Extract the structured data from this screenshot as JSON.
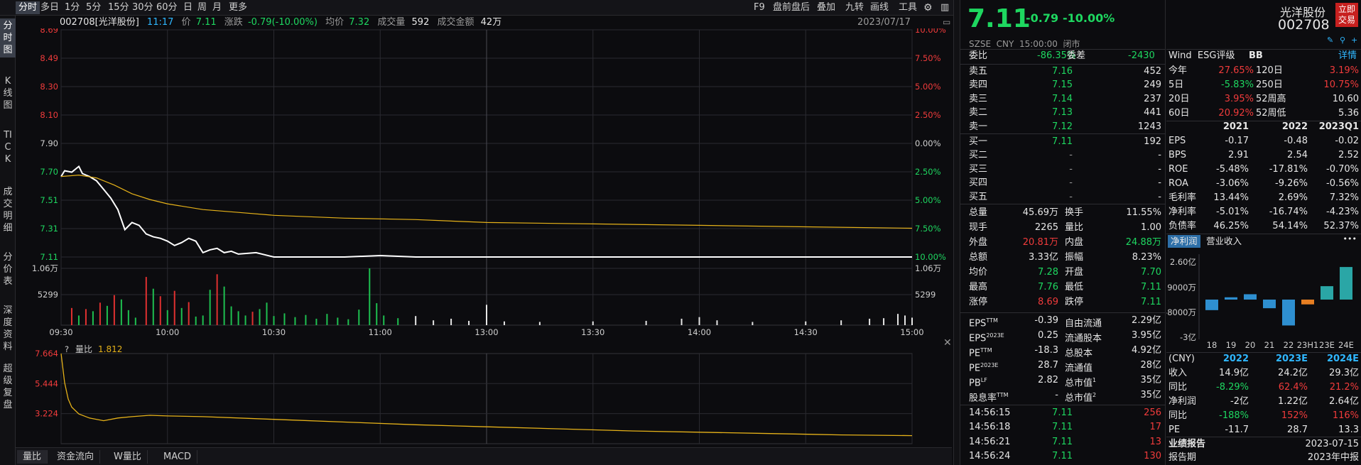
{
  "toolbar": {
    "periods": [
      "分时",
      "多日",
      "1分",
      "5分",
      "15分",
      "30分",
      "60分",
      "日",
      "周",
      "月",
      "更多"
    ],
    "right_items": [
      "F9",
      "盘前盘后",
      "叠加",
      "九转",
      "画线",
      "工具"
    ]
  },
  "left_tabs": [
    "分时图",
    "K线图",
    "TICK",
    "成交明细",
    "分价表",
    "深度资料",
    "超级复盘"
  ],
  "info": {
    "code_name": "002708[光洋股份]",
    "time": "11:17",
    "price_label": "价",
    "price": "7.11",
    "change_label": "涨跌",
    "change": "-0.79(-10.00%)",
    "avg_label": "均价",
    "avg": "7.32",
    "vol_label": "成交量",
    "vol": "592",
    "amount_label": "成交金额",
    "amount": "42万",
    "date": "2023/07/17"
  },
  "chart_data": {
    "type": "line",
    "title": "",
    "price_axis": [
      "8.69",
      "8.49",
      "8.30",
      "8.10",
      "7.90",
      "7.70",
      "7.51",
      "7.31",
      "7.11"
    ],
    "pct_axis": [
      "10.00%",
      "7.50%",
      "5.00%",
      "2.50%",
      "0.00%",
      "2.50%",
      "5.00%",
      "7.50%",
      "10.00%"
    ],
    "vol_axis": [
      "1.06万",
      "5299"
    ],
    "x_ticks": [
      "09:30",
      "10:00",
      "10:30",
      "11:00",
      "13:00",
      "13:30",
      "14:00",
      "14:30",
      "15:00"
    ],
    "prev_close": 7.9,
    "ylim": [
      7.11,
      8.69
    ],
    "series": [
      {
        "name": "价格",
        "color": "#ffffff",
        "x": [
          0,
          1,
          3,
          5,
          6,
          8,
          10,
          12,
          14,
          16,
          18,
          20,
          22,
          24,
          26,
          28,
          30,
          32,
          34,
          36,
          38,
          40,
          42,
          44,
          46,
          48,
          50,
          55,
          60,
          70,
          80,
          90,
          100,
          110,
          120,
          130,
          150,
          170,
          190,
          210,
          240
        ],
        "y": [
          7.67,
          7.71,
          7.7,
          7.74,
          7.69,
          7.67,
          7.64,
          7.58,
          7.52,
          7.44,
          7.3,
          7.35,
          7.33,
          7.27,
          7.25,
          7.24,
          7.22,
          7.19,
          7.21,
          7.24,
          7.22,
          7.14,
          7.16,
          7.17,
          7.14,
          7.15,
          7.13,
          7.14,
          7.11,
          7.11,
          7.11,
          7.12,
          7.11,
          7.11,
          7.11,
          7.11,
          7.11,
          7.11,
          7.11,
          7.11,
          7.11
        ]
      },
      {
        "name": "均价",
        "color": "#e6b219",
        "x": [
          0,
          5,
          10,
          15,
          20,
          25,
          30,
          40,
          50,
          60,
          80,
          100,
          120,
          150,
          180,
          210,
          240
        ],
        "y": [
          7.67,
          7.68,
          7.66,
          7.61,
          7.55,
          7.51,
          7.48,
          7.44,
          7.42,
          7.4,
          7.38,
          7.37,
          7.35,
          7.34,
          7.33,
          7.32,
          7.31
        ]
      }
    ],
    "volume_max": 10600,
    "volume_bars": [
      {
        "t": 3,
        "v": 3200,
        "c": "r"
      },
      {
        "t": 5,
        "v": 1800,
        "c": "g"
      },
      {
        "t": 7,
        "v": 3000,
        "c": "r"
      },
      {
        "t": 9,
        "v": 2600,
        "c": "g"
      },
      {
        "t": 11,
        "v": 4200,
        "c": "r"
      },
      {
        "t": 13,
        "v": 3600,
        "c": "g"
      },
      {
        "t": 15,
        "v": 5600,
        "c": "r"
      },
      {
        "t": 17,
        "v": 4800,
        "c": "g"
      },
      {
        "t": 19,
        "v": 2800,
        "c": "g"
      },
      {
        "t": 21,
        "v": 1400,
        "c": "g"
      },
      {
        "t": 24,
        "v": 9000,
        "c": "r"
      },
      {
        "t": 26,
        "v": 6800,
        "c": "g"
      },
      {
        "t": 28,
        "v": 5400,
        "c": "r"
      },
      {
        "t": 30,
        "v": 2800,
        "c": "g"
      },
      {
        "t": 32,
        "v": 6400,
        "c": "r"
      },
      {
        "t": 34,
        "v": 3200,
        "c": "g"
      },
      {
        "t": 36,
        "v": 4300,
        "c": "r"
      },
      {
        "t": 38,
        "v": 1600,
        "c": "g"
      },
      {
        "t": 40,
        "v": 1800,
        "c": "g"
      },
      {
        "t": 42,
        "v": 6600,
        "c": "g"
      },
      {
        "t": 44,
        "v": 9500,
        "c": "r"
      },
      {
        "t": 46,
        "v": 7200,
        "c": "g"
      },
      {
        "t": 48,
        "v": 3500,
        "c": "g"
      },
      {
        "t": 50,
        "v": 2600,
        "c": "g"
      },
      {
        "t": 52,
        "v": 1800,
        "c": "g"
      },
      {
        "t": 54,
        "v": 2500,
        "c": "r"
      },
      {
        "t": 56,
        "v": 3000,
        "c": "g"
      },
      {
        "t": 58,
        "v": 4200,
        "c": "g"
      },
      {
        "t": 60,
        "v": 1700,
        "c": "g"
      },
      {
        "t": 63,
        "v": 2200,
        "c": "g"
      },
      {
        "t": 66,
        "v": 1500,
        "c": "g"
      },
      {
        "t": 69,
        "v": 1900,
        "c": "g"
      },
      {
        "t": 72,
        "v": 1200,
        "c": "g"
      },
      {
        "t": 75,
        "v": 2100,
        "c": "g"
      },
      {
        "t": 78,
        "v": 1400,
        "c": "g"
      },
      {
        "t": 81,
        "v": 1100,
        "c": "g"
      },
      {
        "t": 84,
        "v": 2900,
        "c": "g"
      },
      {
        "t": 87,
        "v": 10600,
        "c": "g"
      },
      {
        "t": 89,
        "v": 4100,
        "c": "g"
      },
      {
        "t": 91,
        "v": 1800,
        "c": "g"
      },
      {
        "t": 95,
        "v": 1300,
        "c": "g"
      },
      {
        "t": 100,
        "v": 1700,
        "c": "w"
      },
      {
        "t": 105,
        "v": 900,
        "c": "w"
      },
      {
        "t": 110,
        "v": 1200,
        "c": "w"
      },
      {
        "t": 115,
        "v": 800,
        "c": "w"
      },
      {
        "t": 120,
        "v": 3800,
        "c": "w"
      },
      {
        "t": 125,
        "v": 700,
        "c": "w"
      },
      {
        "t": 135,
        "v": 600,
        "c": "w"
      },
      {
        "t": 150,
        "v": 700,
        "c": "w"
      },
      {
        "t": 165,
        "v": 800,
        "c": "w"
      },
      {
        "t": 175,
        "v": 1200,
        "c": "w"
      },
      {
        "t": 180,
        "v": 1500,
        "c": "w"
      },
      {
        "t": 185,
        "v": 900,
        "c": "w"
      },
      {
        "t": 195,
        "v": 600,
        "c": "w"
      },
      {
        "t": 210,
        "v": 700,
        "c": "w"
      },
      {
        "t": 220,
        "v": 900,
        "c": "w"
      },
      {
        "t": 228,
        "v": 1200,
        "c": "w"
      },
      {
        "t": 232,
        "v": 1300,
        "c": "w"
      },
      {
        "t": 236,
        "v": 2100,
        "c": "w"
      },
      {
        "t": 238,
        "v": 1800,
        "c": "w"
      },
      {
        "t": 240,
        "v": 1400,
        "c": "w"
      }
    ],
    "ratio": {
      "label": "量比",
      "value": "1.812",
      "axis": [
        "7.664",
        "5.444",
        "3.224"
      ],
      "x": [
        0,
        1,
        2,
        3,
        5,
        8,
        12,
        16,
        20,
        25,
        30,
        40,
        60,
        80,
        100,
        120,
        140,
        160,
        180,
        200,
        220,
        240
      ],
      "y": [
        7.66,
        5.5,
        4.3,
        3.7,
        3.2,
        2.9,
        2.7,
        2.9,
        3.0,
        3.1,
        3.05,
        3.0,
        2.8,
        2.6,
        2.4,
        2.25,
        2.1,
        1.95,
        1.85,
        1.75,
        1.65,
        1.6
      ],
      "ylim": [
        1.0,
        7.664
      ]
    }
  },
  "bottom_tabs": [
    "量比",
    "资金流向",
    "W量比",
    "MACD"
  ],
  "quote": {
    "price": "7.11",
    "change": "-0.79",
    "pct": "-10.00%",
    "name": "光洋股份",
    "code": "002708",
    "trade_button": "立即交易",
    "exchange_line": "SZSE  CNY  15:00:00  闭市",
    "weibi_label": "委比",
    "weibi": "-86.35%",
    "weicha_label": "委差",
    "weicha": "-2430",
    "asks": [
      {
        "label": "卖五",
        "price": "7.16",
        "vol": "452"
      },
      {
        "label": "卖四",
        "price": "7.15",
        "vol": "249"
      },
      {
        "label": "卖三",
        "price": "7.14",
        "vol": "237"
      },
      {
        "label": "卖二",
        "price": "7.13",
        "vol": "441"
      },
      {
        "label": "卖一",
        "price": "7.12",
        "vol": "1243"
      }
    ],
    "bids": [
      {
        "label": "买一",
        "price": "7.11",
        "vol": "192"
      },
      {
        "label": "买二",
        "price": "-",
        "vol": "-"
      },
      {
        "label": "买三",
        "price": "-",
        "vol": "-"
      },
      {
        "label": "买四",
        "price": "-",
        "vol": "-"
      },
      {
        "label": "买五",
        "price": "-",
        "vol": "-"
      }
    ],
    "stats": [
      {
        "l1": "总量",
        "v1": "45.69万",
        "c1": "wht",
        "l2": "换手",
        "v2": "11.55%",
        "c2": "wht"
      },
      {
        "l1": "现手",
        "v1": "2265",
        "c1": "wht",
        "l2": "量比",
        "v2": "1.00",
        "c2": "wht"
      },
      {
        "l1": "外盘",
        "v1": "20.81万",
        "c1": "red",
        "l2": "内盘",
        "v2": "24.88万",
        "c2": "green"
      },
      {
        "l1": "总额",
        "v1": "3.33亿",
        "c1": "wht",
        "l2": "振幅",
        "v2": "8.23%",
        "c2": "wht"
      },
      {
        "l1": "均价",
        "v1": "7.28",
        "c1": "green",
        "l2": "开盘",
        "v2": "7.70",
        "c2": "green"
      },
      {
        "l1": "最高",
        "v1": "7.76",
        "c1": "green",
        "l2": "最低",
        "v2": "7.11",
        "c2": "green"
      },
      {
        "l1": "涨停",
        "v1": "8.69",
        "c1": "red",
        "l2": "跌停",
        "v2": "7.11",
        "c2": "green"
      }
    ],
    "fundamentals": [
      {
        "l1": "EPS",
        "s1": "TTM",
        "v1": "-0.39",
        "l2": "自由流通",
        "s2": "",
        "v2": "2.29亿"
      },
      {
        "l1": "EPS",
        "s1": "2023E",
        "v1": "0.25",
        "l2": "流通股本",
        "s2": "",
        "v2": "3.95亿"
      },
      {
        "l1": "PE",
        "s1": "TTM",
        "v1": "-18.3",
        "l2": "总股本",
        "s2": "",
        "v2": "4.92亿"
      },
      {
        "l1": "PE",
        "s1": "2023E",
        "v1": "28.7",
        "l2": "流通值",
        "s2": "",
        "v2": "28亿"
      },
      {
        "l1": "PB",
        "s1": "LF",
        "v1": "2.82",
        "l2": "总市值",
        "s2": "1",
        "v2": "35亿"
      },
      {
        "l1": "股息率",
        "s1": "TTM",
        "v1": "-",
        "l2": "总市值",
        "s2": "2",
        "v2": "35亿"
      }
    ],
    "ticks": [
      {
        "time": "14:56:15",
        "price": "7.11",
        "vol": "256"
      },
      {
        "time": "14:56:18",
        "price": "7.11",
        "vol": "17"
      },
      {
        "time": "14:56:21",
        "price": "7.11",
        "vol": "13"
      },
      {
        "time": "14:56:24",
        "price": "7.11",
        "vol": "130"
      }
    ]
  },
  "side": {
    "esg_label": "Wind  ESG评级",
    "esg": "BB",
    "detail": "详情",
    "returns": [
      {
        "l1": "今年",
        "v1": "27.65%",
        "c1": "red",
        "l2": "120日",
        "v2": "3.19%",
        "c2": "red"
      },
      {
        "l1": "5日",
        "v1": "-5.83%",
        "c1": "green",
        "l2": "250日",
        "v2": "10.75%",
        "c2": "red"
      },
      {
        "l1": "20日",
        "v1": "3.95%",
        "c1": "red",
        "l2": "52周高",
        "v2": "10.60",
        "c2": "wht"
      },
      {
        "l1": "60日",
        "v1": "20.92%",
        "c1": "red",
        "l2": "52周低",
        "v2": "5.36",
        "c2": "wht"
      }
    ],
    "fin_header": [
      "2021",
      "2022",
      "2023Q1"
    ],
    "fin_rows": [
      {
        "label": "EPS",
        "vals": [
          "-0.17",
          "-0.48",
          "-0.02"
        ]
      },
      {
        "label": "BPS",
        "vals": [
          "2.91",
          "2.54",
          "2.52"
        ]
      },
      {
        "label": "ROE",
        "vals": [
          "-5.48%",
          "-17.81%",
          "-0.70%"
        ]
      },
      {
        "label": "ROA",
        "vals": [
          "-3.06%",
          "-9.26%",
          "-0.56%"
        ]
      },
      {
        "label": "毛利率",
        "vals": [
          "13.44%",
          "2.69%",
          "7.32%"
        ]
      },
      {
        "label": "净利率",
        "vals": [
          "-5.01%",
          "-16.74%",
          "-4.23%"
        ]
      },
      {
        "label": "负债率",
        "vals": [
          "46.25%",
          "54.14%",
          "52.37%"
        ]
      }
    ],
    "tabs": [
      "净利润",
      "营业收入"
    ],
    "more": "•••",
    "bar_axis": [
      "2.60亿",
      "9000万",
      "-8000万",
      "-3亿"
    ],
    "bar_labels": [
      "18",
      "19",
      "20",
      "21",
      "22",
      "23H1",
      "23E",
      "24E"
    ],
    "bar_values": [
      -0.55,
      0.12,
      0.28,
      -0.45,
      -1.35,
      -0.25,
      0.7,
      1.7
    ],
    "bar_colors": [
      "#2e8fd0",
      "#2e8fd0",
      "#2e8fd0",
      "#2e8fd0",
      "#2e8fd0",
      "#e67e22",
      "#2aa6a6",
      "#2aa6a6"
    ],
    "forecast_header": [
      "(CNY)",
      "2022",
      "2023E",
      "2024E"
    ],
    "forecast_rows": [
      {
        "label": "收入",
        "vals": [
          "14.9亿",
          "24.2亿",
          "29.3亿"
        ],
        "cls": [
          "wht",
          "wht",
          "wht"
        ]
      },
      {
        "label": "同比",
        "vals": [
          "-8.29%",
          "62.4%",
          "21.2%"
        ],
        "cls": [
          "green",
          "red",
          "red"
        ]
      },
      {
        "label": "净利润",
        "vals": [
          "-2亿",
          "1.22亿",
          "2.64亿"
        ],
        "cls": [
          "wht",
          "wht",
          "wht"
        ]
      },
      {
        "label": "同比",
        "vals": [
          "-188%",
          "152%",
          "116%"
        ],
        "cls": [
          "green",
          "red",
          "red"
        ]
      },
      {
        "label": "PE",
        "vals": [
          "-11.7",
          "28.7",
          "13.3"
        ],
        "cls": [
          "wht",
          "wht",
          "wht"
        ]
      }
    ],
    "report_label": "业绩报告",
    "report_date": "2023-07-15",
    "report_period_label": "报告期",
    "report_period": "2023年中报"
  }
}
